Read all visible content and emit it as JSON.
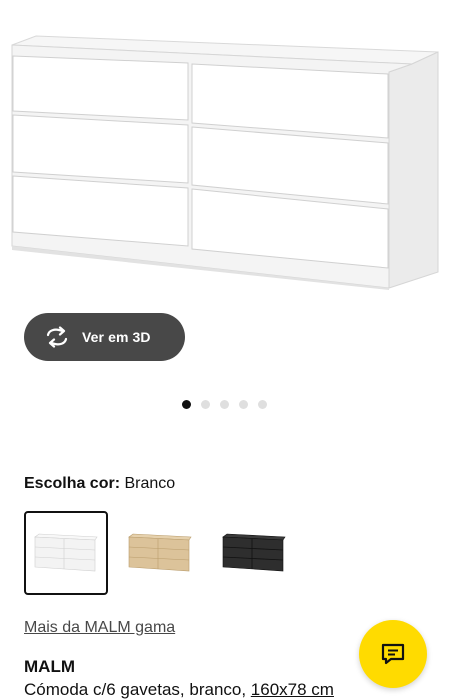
{
  "product_image": {
    "alt": "MALM Cómoda c/6 gavetas, branco"
  },
  "view3d": {
    "label": "Ver em 3D",
    "icon": "rotate-3d-icon"
  },
  "carousel": {
    "count": 5,
    "active_index": 0
  },
  "color": {
    "label": "Escolha cor:",
    "value": "Branco"
  },
  "swatches": [
    {
      "name": "Branco",
      "color": "#f3f3f3",
      "selected": true
    },
    {
      "name": "Folheado carvalho",
      "color": "#dcc39a",
      "selected": false
    },
    {
      "name": "Preto-castanho",
      "color": "#2e2e2e",
      "selected": false
    }
  ],
  "range_link": "Mais da MALM gama",
  "product": {
    "name": "MALM",
    "description": "Cómoda c/6 gavetas, branco, ",
    "measure": "160x78 cm"
  },
  "chat": {
    "icon": "chat-icon",
    "color": "#ffdb00"
  }
}
